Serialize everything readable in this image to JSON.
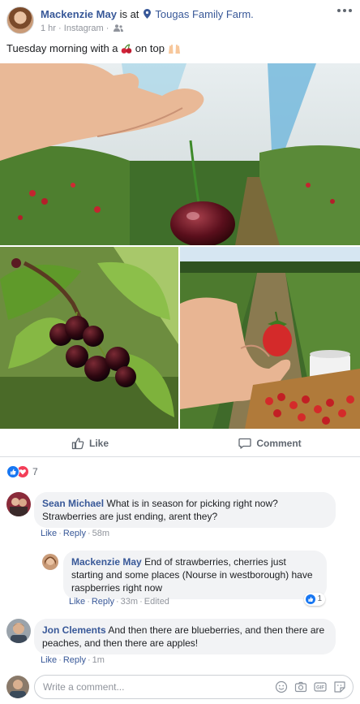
{
  "post": {
    "author": "Mackenzie May",
    "is_at_text": "is at",
    "place": "Tougas Family Farm.",
    "time": "1 hr",
    "source": "Instagram",
    "caption_before": "Tuesday morning with a",
    "caption_after": "on top",
    "icons": [
      "map-pin-icon",
      "friends-icon",
      "more-icon",
      "cherry-emoji-icon",
      "raised-hands-emoji-icon"
    ]
  },
  "actions": {
    "like_label": "Like",
    "comment_label": "Comment"
  },
  "reactions": {
    "count": "7",
    "types": [
      "like",
      "love"
    ]
  },
  "comments": [
    {
      "name": "Sean Michael",
      "text": "What is in season for picking right now? Strawberries are just ending, arent they?",
      "like": "Like",
      "reply": "Reply",
      "time": "58m"
    },
    {
      "name": "Mackenzie May",
      "text": "End of strawberries, cherries just starting and some places (Nourse in westborough) have raspberries right now",
      "like": "Like",
      "reply": "Reply",
      "time": "33m",
      "edited": "Edited",
      "reaction_count": "1"
    },
    {
      "name": "Jon Clements",
      "text": "And then there are blueberries, and then there are peaches, and then there are apples!",
      "like": "Like",
      "reply": "Reply",
      "time": "1m"
    }
  ],
  "composer": {
    "placeholder": "Write a comment...",
    "icons": [
      "emoji-icon",
      "camera-icon",
      "gif-icon",
      "sticker-icon"
    ]
  },
  "colors": {
    "link": "#385898",
    "muted": "#90949c",
    "bubble": "#f2f3f5",
    "like_blue": "#1877f2",
    "love_red": "#f33e58"
  }
}
